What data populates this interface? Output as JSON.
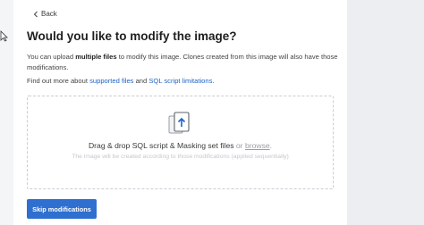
{
  "back": {
    "label": "Back"
  },
  "title": "Would you like to modify the image?",
  "description": {
    "part1": "You can upload ",
    "bold": "multiple files",
    "part2": " to modify this image. Clones created from this image will also have those modifications."
  },
  "more": {
    "prefix": "Find out more about ",
    "link1": "supported files",
    "middle": " and ",
    "link2": "SQL script limitations",
    "suffix": "."
  },
  "dropzone": {
    "icon": "file-upload-icon",
    "text": "Drag & drop SQL script & Masking set files",
    "or": " or ",
    "browse": "browse",
    "end": ".",
    "hint": "The image will be created according to those modifications (applied sequentially)"
  },
  "skip_button": "Skip modifications",
  "colors": {
    "primary": "#2f6fcf",
    "link": "#1e63c4",
    "background": "#f4f5f7"
  }
}
